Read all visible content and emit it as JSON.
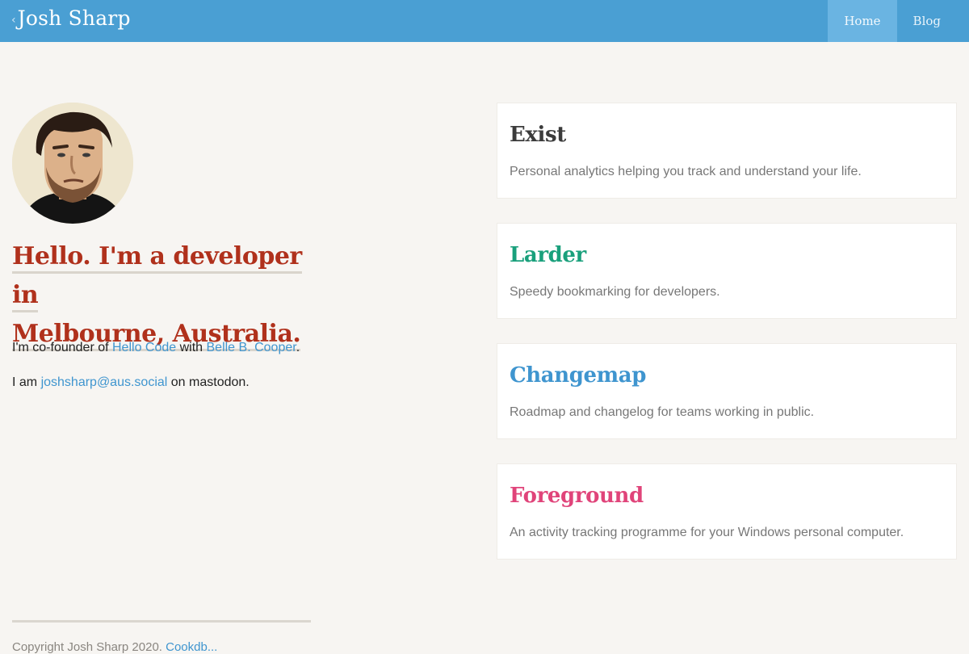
{
  "header": {
    "brand_chevron": "‹",
    "brand_name": "Josh Sharp",
    "nav": [
      {
        "label": "Home",
        "active": true
      },
      {
        "label": "Blog",
        "active": false
      }
    ]
  },
  "intro": {
    "headline_line1": "Hello. I'm a developer in",
    "headline_line2": "Melbourne, Australia.",
    "bio1_prefix": "I'm co-founder of ",
    "bio1_link1": "Hello Code",
    "bio1_mid": " with ",
    "bio1_link2": "Belle B. Cooper",
    "bio1_suffix": ".",
    "bio2_prefix": "I am ",
    "bio2_link": "joshsharp@aus.social",
    "bio2_suffix": " on mastodon."
  },
  "projects": [
    {
      "title": "Exist",
      "description": "Personal analytics helping you track and understand your life.",
      "color": "#3b3b3b"
    },
    {
      "title": "Larder",
      "description": "Speedy bookmarking for developers.",
      "color": "#1aa07c"
    },
    {
      "title": "Changemap",
      "description": "Roadmap and changelog for teams working in public.",
      "color": "#3f95cf"
    },
    {
      "title": "Foreground",
      "description": "An activity tracking programme for your Windows personal computer.",
      "color": "#e0447a"
    }
  ],
  "footer": {
    "copyright": "Copyright Josh Sharp 2020. ",
    "link": "Cookdb..."
  },
  "colors": {
    "header_bg": "#4a9fd3",
    "headline": "#b0311c",
    "link": "#3f95cf",
    "page_bg": "#f7f5f2"
  }
}
